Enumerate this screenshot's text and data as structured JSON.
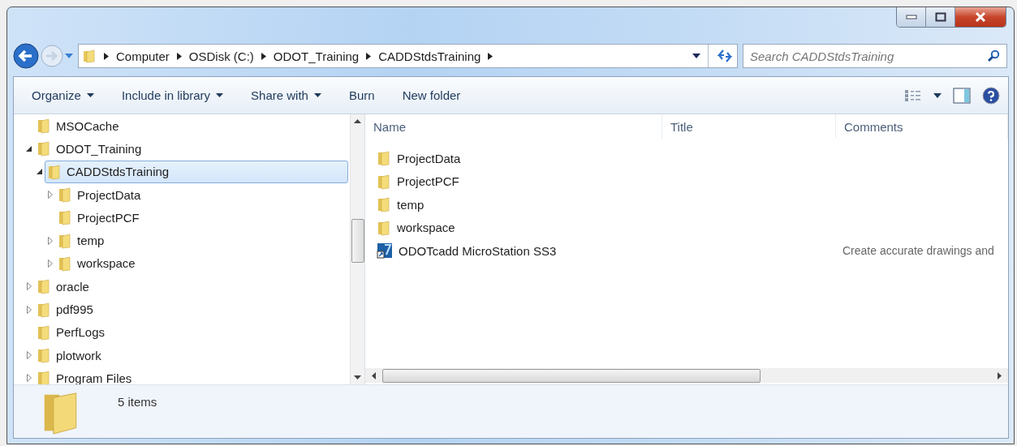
{
  "address_bar": {
    "crumbs": [
      "Computer",
      "OSDisk (C:)",
      "ODOT_Training",
      "CADDStdsTraining"
    ]
  },
  "search": {
    "placeholder": "Search CADDStdsTraining"
  },
  "toolbar": {
    "buttons": [
      {
        "label": "Organize",
        "has_menu": true
      },
      {
        "label": "Include in library",
        "has_menu": true
      },
      {
        "label": "Share with",
        "has_menu": true
      },
      {
        "label": "Burn",
        "has_menu": false
      },
      {
        "label": "New folder",
        "has_menu": false
      }
    ]
  },
  "navigation_tree": [
    {
      "label": "MSOCache",
      "expandable": false,
      "selected": false
    },
    {
      "label": "ODOT_Training",
      "expandable": true,
      "expanded": true,
      "selected": false,
      "children": [
        {
          "label": "CADDStdsTraining",
          "expandable": true,
          "expanded": true,
          "selected": true,
          "children": [
            {
              "label": "ProjectData",
              "expandable": true,
              "expanded": false,
              "selected": false
            },
            {
              "label": "ProjectPCF",
              "expandable": false,
              "selected": false
            },
            {
              "label": "temp",
              "expandable": true,
              "expanded": false,
              "selected": false
            },
            {
              "label": "workspace",
              "expandable": true,
              "expanded": false,
              "selected": false
            }
          ]
        }
      ]
    },
    {
      "label": "oracle",
      "expandable": true,
      "expanded": false,
      "selected": false
    },
    {
      "label": "pdf995",
      "expandable": true,
      "expanded": false,
      "selected": false
    },
    {
      "label": "PerfLogs",
      "expandable": false,
      "selected": false
    },
    {
      "label": "plotwork",
      "expandable": true,
      "expanded": false,
      "selected": false
    },
    {
      "label": "Program Files",
      "expandable": true,
      "expanded": false,
      "selected": false
    }
  ],
  "file_list": {
    "columns": [
      "Name",
      "Title",
      "Comments"
    ],
    "rows": [
      {
        "kind": "folder",
        "name": "ProjectData"
      },
      {
        "kind": "folder",
        "name": "ProjectPCF"
      },
      {
        "kind": "folder",
        "name": "temp"
      },
      {
        "kind": "folder",
        "name": "workspace"
      },
      {
        "kind": "app",
        "name": "ODOTcadd MicroStation SS3",
        "comments": "Create accurate drawings and"
      }
    ]
  },
  "status_bar": {
    "count": "5 items"
  }
}
